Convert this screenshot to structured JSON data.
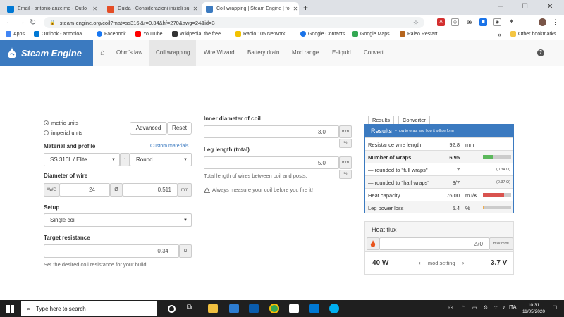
{
  "browser": {
    "tabs": [
      {
        "title": "Email - antonio anzelmo - Outlo",
        "favicon_color": "#0078d4"
      },
      {
        "title": "Guida - Considerazioni iniziali su",
        "favicon_color": "#e44d26"
      },
      {
        "title": "Coil wrapping | Steam Engine | fo",
        "favicon_color": "#3b7ac0"
      }
    ],
    "new_tab": "+",
    "url": "steam-engine.org/coil?mat=ss316l&r=0.34&hf=270&awg=24&id=3",
    "bookmarks": [
      {
        "label": "Apps",
        "color": "#4285f4"
      },
      {
        "label": "Outlook - antonioa...",
        "color": "#0078d4"
      },
      {
        "label": "Facebook",
        "color": "#1877f2"
      },
      {
        "label": "YouTube",
        "color": "#ff0000"
      },
      {
        "label": "Wikipedia, the free...",
        "color": "#333333"
      },
      {
        "label": "Radio 105 Network...",
        "color": "#f2c200"
      },
      {
        "label": "Google Contacts",
        "color": "#1a73e8"
      },
      {
        "label": "Google Maps",
        "color": "#34a853"
      },
      {
        "label": "Paleo Restart",
        "color": "#b5651d"
      }
    ],
    "more": "»",
    "other_bookmarks": "Other bookmarks"
  },
  "site": {
    "brand": "Steam Engine",
    "nav": [
      "Ohm's law",
      "Coil wrapping",
      "Wire Wizard",
      "Battery drain",
      "Mod range",
      "E-liquid",
      "Convert"
    ],
    "active_nav": "Coil wrapping",
    "help": "?"
  },
  "form": {
    "units": {
      "metric": "metric units",
      "imperial": "imperial units",
      "selected": "metric"
    },
    "advanced": "Advanced",
    "reset": "Reset",
    "material_label": "Material and profile",
    "custom_materials": "Custom materials",
    "material": "SS 316L / Elite",
    "profile_sep": ":",
    "profile": "Round",
    "diameter_label": "Diameter of wire",
    "awg_label": "AWG",
    "awg": "24",
    "dia_prefix": "Ø",
    "diameter": "0.511",
    "diameter_unit": "mm",
    "setup_label": "Setup",
    "setup": "Single coil",
    "target_label": "Target resistance",
    "target": "0.34",
    "target_unit": "Ω",
    "target_help": "Set the desired coil resistance for your build.",
    "inner_label": "Inner diameter of coil",
    "inner": "3.0",
    "inner_unit": "mm",
    "leg_label": "Leg length (total)",
    "leg": "5.0",
    "leg_unit": "mm",
    "leg_help": "Total length of wires between coil and posts.",
    "warning": "Always measure your coil before you fire it!"
  },
  "results": {
    "tabs": [
      "Results",
      "Converter"
    ],
    "title": "Results",
    "subtitle": "– how to wrap, and how it will perform",
    "rows": [
      {
        "key": "Resistance wire length",
        "value": "92.8",
        "unit": "mm"
      },
      {
        "key": "Number of wraps",
        "value": "6.95",
        "bar": 0.35,
        "bar_color": "#5cb85c"
      },
      {
        "key": "— rounded to \"full wraps\"",
        "value": "7",
        "extra": "(0.34 Ω)"
      },
      {
        "key": "— rounded to \"half wraps\"",
        "value": "8/7",
        "extra": "(0.37 Ω)"
      },
      {
        "key": "Heat capacity",
        "value": "76.00",
        "unit": "mJ/K",
        "bar": 0.75,
        "bar_color": "#d9534f"
      },
      {
        "key": "Leg power loss",
        "value": "5.4",
        "unit": "%",
        "bar": 0.05,
        "bar_color": "#f0ad4e"
      }
    ]
  },
  "heatflux": {
    "title": "Heat flux",
    "value": "270",
    "unit": "mW/mm²",
    "watts": "40 W",
    "mod_setting": "⟵ mod setting ⟶",
    "volts": "3.7 V"
  },
  "taskbar": {
    "search": "Type here to search",
    "lang": "ITA",
    "time": "10:31",
    "date": "11/05/2020"
  }
}
